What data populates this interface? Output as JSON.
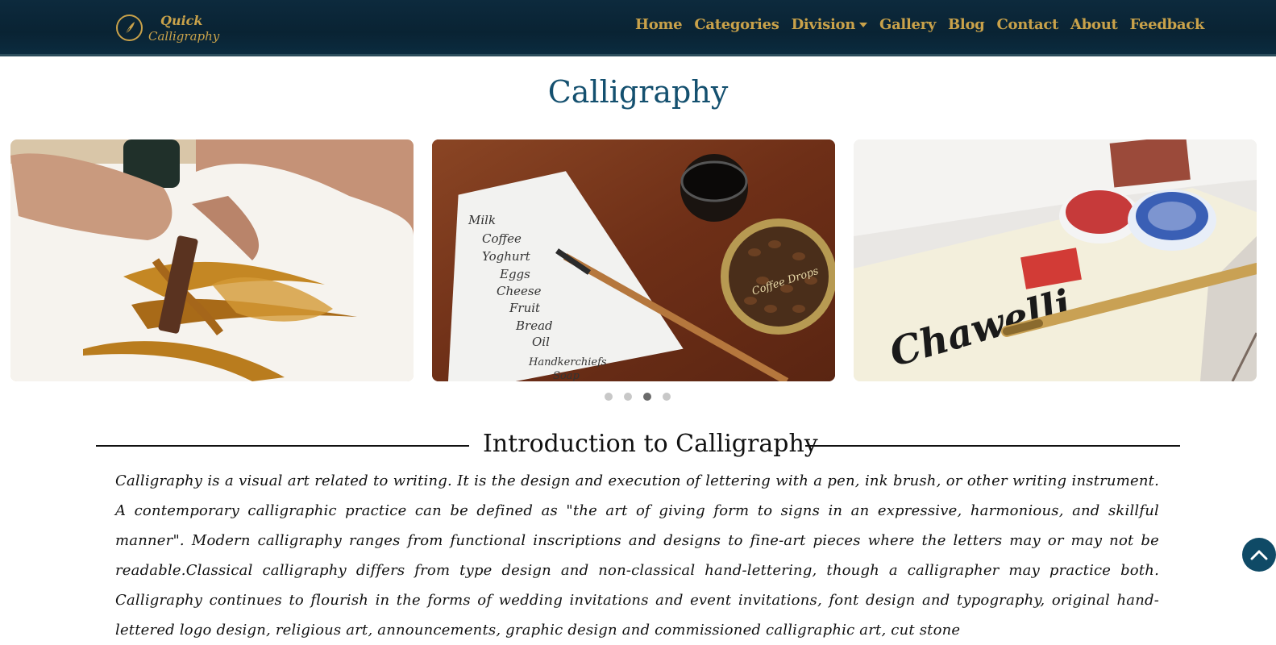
{
  "brand": {
    "line1": "Quick",
    "line2": "Calligraphy",
    "icon": "quill-pen-emblem-icon"
  },
  "nav": {
    "items": [
      {
        "label": "Home"
      },
      {
        "label": "Categories"
      },
      {
        "label": "Division",
        "has_dropdown": true
      },
      {
        "label": "Gallery"
      },
      {
        "label": "Blog"
      },
      {
        "label": "Contact"
      },
      {
        "label": "About"
      },
      {
        "label": "Feedback"
      }
    ]
  },
  "page_title": "Calligraphy",
  "carousel": {
    "slides": [
      {
        "icon": "brush-calligraphy-image"
      },
      {
        "icon": "pen-nib-shopping-list-image",
        "list_text": [
          "Milk",
          "Coffee",
          "Yoghurt",
          "Eggs",
          "Cheese",
          "Fruit",
          "Bread",
          "Oil",
          "Handkerchiefs",
          "Soap"
        ],
        "tin_label": "Coffee Drops"
      },
      {
        "icon": "gothic-lettering-seal-image",
        "word": "Chawelli"
      }
    ],
    "active_index": 2,
    "dot_count": 4
  },
  "section": {
    "heading": "Introduction to Calligraphy",
    "body": "Calligraphy is a visual art related to writing. It is the design and execution of lettering with a pen, ink brush, or other writing instrument. A contemporary calligraphic practice can be defined as \"the art of giving form to signs in an expressive, harmonious, and skillful manner\". Modern calligraphy ranges from functional inscriptions and designs to fine-art pieces where the letters may or may not be readable.Classical calligraphy differs from type design and non-classical hand-lettering, though a calligrapher may practice both. Calligraphy continues to flourish in the forms of wedding invitations and event invitations, font design and typography, original hand-lettered logo design, religious art, announcements, graphic design and commissioned calligraphic art, cut stone"
  },
  "colors": {
    "nav_bg": "#0b2636",
    "gold": "#c9a24a",
    "title_blue": "#14506f",
    "back_to_top_bg": "#0f4a66"
  },
  "back_to_top": {
    "icon": "chevron-up-icon"
  }
}
